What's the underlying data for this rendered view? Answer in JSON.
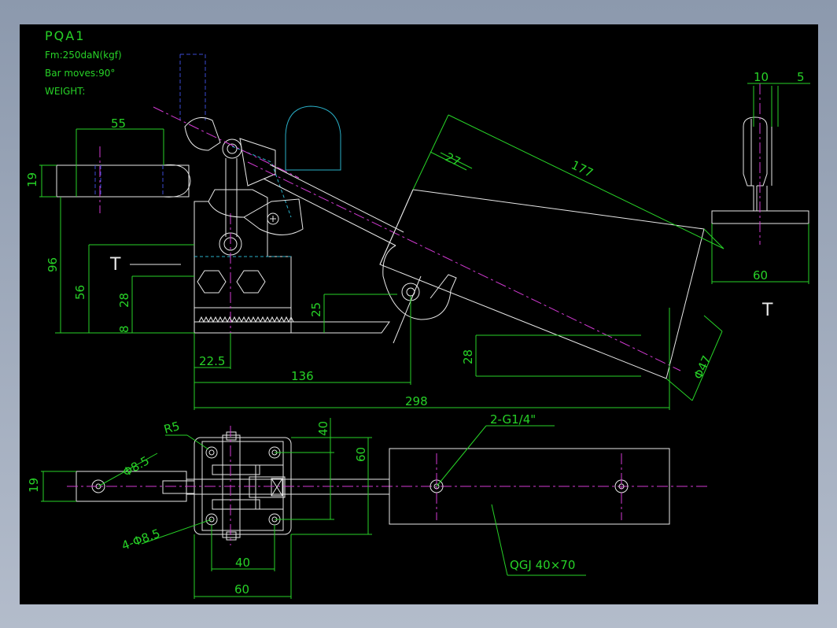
{
  "title_block": {
    "model": "PQA1",
    "force": "Fm:250daN(kgf)",
    "bar_moves": "Bar moves:90°",
    "weight": "WEIGHT:"
  },
  "side_view": {
    "dim_55": "55",
    "dim_19": "19",
    "dim_96": "96",
    "dim_56": "56",
    "dim_28": "28",
    "dim_8": "8",
    "dim_25": "25",
    "dim_28_right": "28",
    "dim_22_5": "22.5",
    "dim_136": "136",
    "dim_298": "298",
    "dim_27": "27",
    "dim_177": "177",
    "dim_phi47": "Φ47",
    "section_mark": "T"
  },
  "end_view": {
    "dim_10": "10",
    "dim_5": "5",
    "dim_60": "60",
    "section_mark": "T"
  },
  "plan_view": {
    "r5": "R5",
    "phi8_5": "Φ8.5",
    "dim_19": "19",
    "holes_4x": "4-Φ8.5",
    "dim_40_top": "40",
    "dim_60_top": "60",
    "dim_40_bottom": "40",
    "dim_60_bottom": "60",
    "port_callout": "2-G1/4\"",
    "cylinder_callout": "QGJ 40×70"
  }
}
